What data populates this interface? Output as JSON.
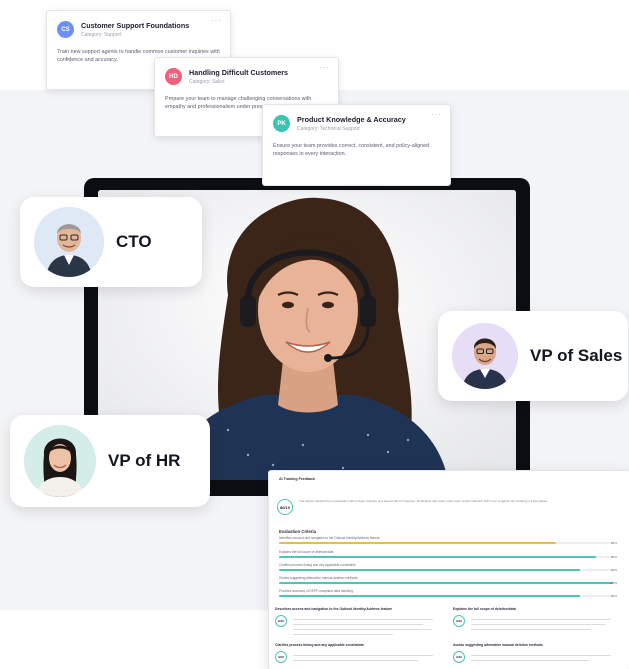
{
  "course_cards": [
    {
      "initials": "CS",
      "title": "Customer Support Foundations",
      "category": "Category: Support",
      "description": "Train new support agents to handle common customer inquiries with confidence and accuracy.",
      "menu": "···",
      "badge_color": "#6f8ff6"
    },
    {
      "initials": "HD",
      "title": "Handling Difficult Customers",
      "category": "Category: Sales",
      "description": "Prepare your team to manage challenging conversations with empathy and professionalism under pressure.",
      "menu": "···",
      "badge_color": "#f0607a"
    },
    {
      "initials": "PK",
      "title": "Product Knowledge & Accuracy",
      "category": "Category: Technical Support",
      "description": "Ensure your team provides correct, consistent, and policy-aligned responses in every interaction.",
      "menu": "···",
      "badge_color": "#3cc3b1"
    }
  ],
  "roles": {
    "cto": "CTO",
    "vp_sales": "VP of Sales",
    "vp_hr": "VP of HR"
  },
  "feedback": {
    "title": "AI Training Feedback",
    "overall_score": "86/10",
    "intro": "The trainee handled the conversation with a clear structure and stayed calm throughout. Verification and policy steps were mostly followed, with room to tighten the wording in a few places.",
    "criteria_title": "Evaluation Criteria",
    "criteria": [
      {
        "label": "Identifies account and navigates to the Outlook Identity/Address feature",
        "value": 83,
        "color": "#f2b64a",
        "pct": "83%"
      },
      {
        "label": "Explains the full scope of deletion/data",
        "value": 95,
        "color": "#4cc6b8",
        "pct": "95%"
      },
      {
        "label": "Clarifies process timing and any applicable constraints",
        "value": 90,
        "color": "#4cc6b8",
        "pct": "90%"
      },
      {
        "label": "Guides suggesting alternative manual deletion methods",
        "value": 100,
        "color": "#4cc6b8",
        "pct": "100%"
      },
      {
        "label": "Provides accuracy of DSPP-compliant data handling",
        "value": 90,
        "color": "#4cc6b8",
        "pct": "90%"
      }
    ],
    "sections": [
      {
        "title": "Describes access and navigation to the Outlook Identity/Address feature",
        "score": "8/10"
      },
      {
        "title": "Explains the full scope of deletion/data",
        "score": "9/10"
      },
      {
        "title": "Clarifies process timing and any applicable constraints",
        "score": "9/10"
      },
      {
        "title": "Avoids suggesting alternative manual deletion methods",
        "score": "9/10"
      }
    ]
  }
}
